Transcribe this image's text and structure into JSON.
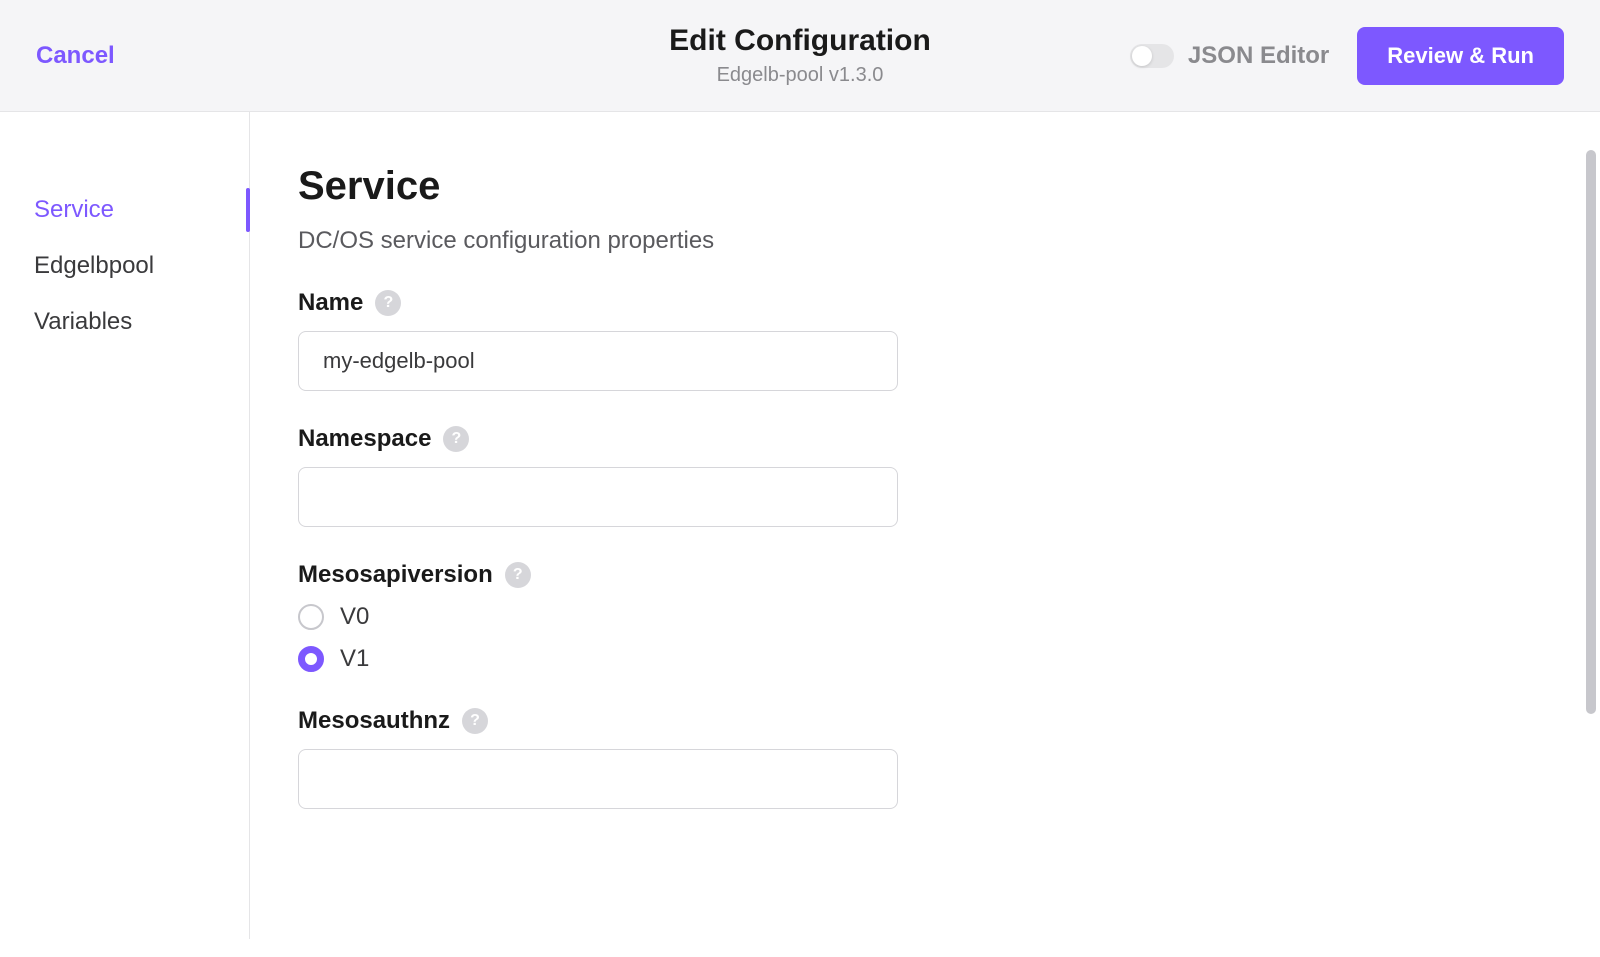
{
  "header": {
    "cancel_label": "Cancel",
    "title": "Edit Configuration",
    "subtitle": "Edgelb-pool v1.3.0",
    "json_toggle_label": "JSON Editor",
    "primary_button_label": "Review & Run"
  },
  "sidebar": {
    "items": [
      {
        "label": "Service",
        "active": true
      },
      {
        "label": "Edgelbpool",
        "active": false
      },
      {
        "label": "Variables",
        "active": false
      }
    ]
  },
  "main": {
    "section_title": "Service",
    "section_desc": "DC/OS service configuration properties",
    "fields": {
      "name": {
        "label": "Name",
        "value": "my-edgelb-pool"
      },
      "namespace": {
        "label": "Namespace",
        "value": ""
      },
      "mesosapiversion": {
        "label": "Mesosapiversion",
        "options": [
          {
            "label": "V0",
            "selected": false
          },
          {
            "label": "V1",
            "selected": true
          }
        ]
      },
      "mesosauthnz": {
        "label": "Mesosauthnz",
        "value": ""
      }
    },
    "help_glyph": "?"
  }
}
